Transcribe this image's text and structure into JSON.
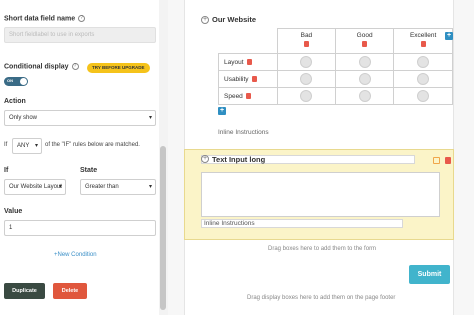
{
  "settings": {
    "short_data_field_label": "Short data field name",
    "short_data_field_placeholder": "Short fieldlabel to use in exports",
    "conditional_display_label": "Conditional display",
    "upgrade_badge": "TRY BEFORE UPGRADE",
    "toggle_label": "ON",
    "action_label": "Action",
    "action_value": "Only show",
    "if_prefix": "If",
    "if_rule_value": "ANY",
    "if_suffix": "of the \"IF\" rules below are matched.",
    "if_label": "If",
    "if_field_value": "Our Website Layout",
    "state_label": "State",
    "state_value": "Greater than",
    "value_label": "Value",
    "value_value": "1",
    "new_condition": "New Condition",
    "duplicate_button": "Duplicate",
    "delete_button": "Delete"
  },
  "form": {
    "matrix_title": "Our Website",
    "columns": [
      "Bad",
      "Good",
      "Excellent"
    ],
    "rows": [
      "Layout",
      "Usability",
      "Speed"
    ],
    "inline_instructions_1": "Inline Instructions",
    "text_input_title": "Text Input long",
    "inline_instructions_2": "Inline Instructions",
    "dropzone_form": "Drag boxes here to add them to the form",
    "submit_label": "Submit",
    "dropzone_footer": "Drag display boxes here to add them on the page footer"
  },
  "colors": {
    "accent": "#41b4cc",
    "toggle": "#3a6b86",
    "duplicate": "#3a4a42",
    "delete": "#e0573d",
    "upgrade": "#f5c31b",
    "highlight": "#fbf4c8"
  },
  "icons": [
    "help-icon",
    "plus-circle-icon",
    "trash-icon",
    "copy-icon",
    "add-column-icon",
    "add-row-icon",
    "chevron-down-icon"
  ]
}
